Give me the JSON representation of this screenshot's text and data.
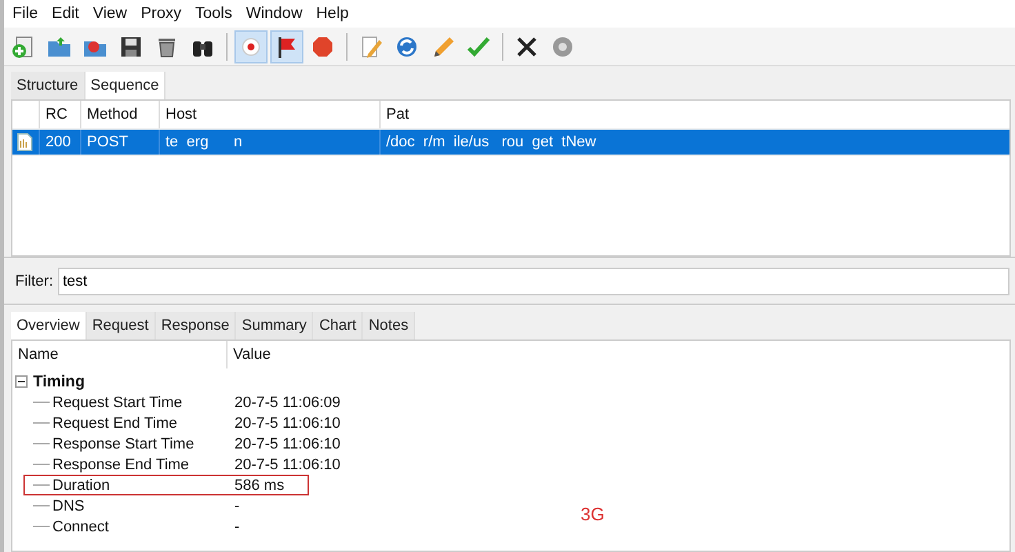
{
  "menu": [
    "File",
    "Edit",
    "View",
    "Proxy",
    "Tools",
    "Window",
    "Help"
  ],
  "toolbar": [
    [
      {
        "selected": false
      },
      {
        "selected": false
      },
      {
        "selected": false
      },
      {
        "selected": false
      },
      {
        "selected": false
      },
      {
        "selected": false
      }
    ],
    [
      {
        "selected": true
      },
      {
        "selected": true
      },
      {
        "selected": false
      }
    ],
    [
      {
        "selected": false
      },
      {
        "selected": false
      },
      {
        "selected": false
      },
      {
        "selected": false
      }
    ],
    [
      {
        "selected": false
      },
      {
        "selected": false
      }
    ]
  ],
  "view_tabs": [
    {
      "label": "Structure",
      "selected": false
    },
    {
      "label": "Sequence",
      "selected": true
    }
  ],
  "table": {
    "columns": [
      "RC",
      "Method",
      "Host",
      "Pat"
    ],
    "rows": [
      {
        "selected": true,
        "cells": [
          "200",
          "POST",
          "te  erg      n",
          "/doc  r/m  ile/us   rou  get  tNew"
        ]
      }
    ]
  },
  "filter": {
    "label": "Filter:",
    "value": "test"
  },
  "detail_tabs": [
    {
      "label": "Overview",
      "selected": true
    },
    {
      "label": "Request",
      "selected": false
    },
    {
      "label": "Response",
      "selected": false
    },
    {
      "label": "Summary",
      "selected": false
    },
    {
      "label": "Chart",
      "selected": false
    },
    {
      "label": "Notes",
      "selected": false
    }
  ],
  "tree": {
    "columns": [
      "Name",
      "Value"
    ],
    "items": [
      {
        "name": "Timing",
        "expanded": true,
        "children": [
          {
            "name": "Request Start Time",
            "value": "20-7-5 11:06:09",
            "highlighted": false
          },
          {
            "name": "Request End Time",
            "value": "20-7-5 11:06:10",
            "highlighted": false
          },
          {
            "name": "Response Start Time",
            "value": "20-7-5 11:06:10",
            "highlighted": false
          },
          {
            "name": "Response End Time",
            "value": "20-7-5 11:06:10",
            "highlighted": false
          },
          {
            "name": "Duration",
            "value": "586 ms",
            "highlighted": true
          },
          {
            "name": "DNS",
            "value": "-",
            "highlighted": false
          },
          {
            "name": "Connect",
            "value": "-",
            "highlighted": false
          }
        ]
      }
    ]
  },
  "note": "3G"
}
